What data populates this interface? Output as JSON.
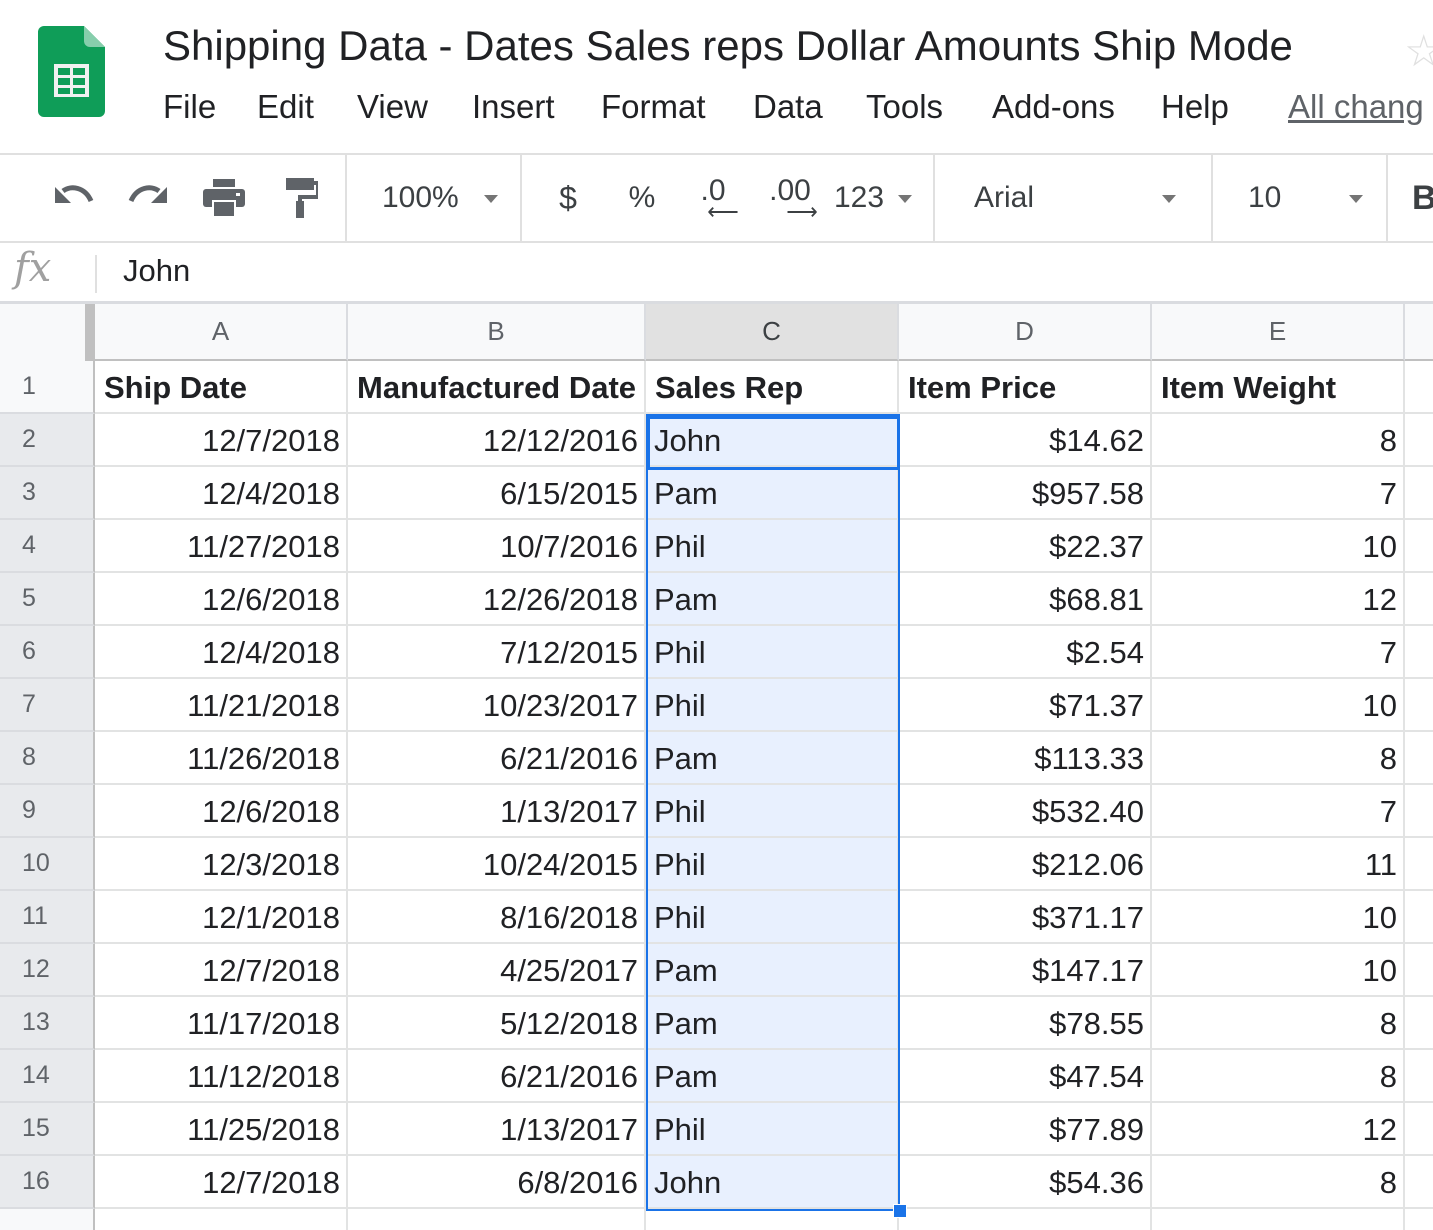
{
  "app": {
    "title": "Shipping Data - Dates Sales reps Dollar Amounts Ship Mode",
    "star_icon": "star-icon",
    "brand_color": "#0f9d58"
  },
  "menu": [
    "File",
    "Edit",
    "View",
    "Insert",
    "Format",
    "Data",
    "Tools",
    "Add-ons",
    "Help"
  ],
  "all_changes": "All chang",
  "toolbar": {
    "zoom": "100%",
    "currency": "$",
    "percent": "%",
    "decrease_decimal": ".0",
    "increase_decimal": ".00",
    "more_formats": "123",
    "font": "Arial",
    "font_size": "10",
    "bold": "B"
  },
  "formula_bar": {
    "fx_label": "fx",
    "value": "John"
  },
  "grid": {
    "columns": [
      "A",
      "B",
      "C",
      "D",
      "E"
    ],
    "selected_column": "C",
    "active_cell": "C2",
    "header": [
      "Ship Date",
      "Manufactured Date",
      "Sales Rep",
      "Item Price",
      "Item Weight"
    ],
    "rows": [
      [
        "12/7/2018",
        "12/12/2016",
        "John",
        "$14.62",
        "8"
      ],
      [
        "12/4/2018",
        "6/15/2015",
        "Pam",
        "$957.58",
        "7"
      ],
      [
        "11/27/2018",
        "10/7/2016",
        "Phil",
        "$22.37",
        "10"
      ],
      [
        "12/6/2018",
        "12/26/2018",
        "Pam",
        "$68.81",
        "12"
      ],
      [
        "12/4/2018",
        "7/12/2015",
        "Phil",
        "$2.54",
        "7"
      ],
      [
        "11/21/2018",
        "10/23/2017",
        "Phil",
        "$71.37",
        "10"
      ],
      [
        "11/26/2018",
        "6/21/2016",
        "Pam",
        "$113.33",
        "8"
      ],
      [
        "12/6/2018",
        "1/13/2017",
        "Phil",
        "$532.40",
        "7"
      ],
      [
        "12/3/2018",
        "10/24/2015",
        "Phil",
        "$212.06",
        "11"
      ],
      [
        "12/1/2018",
        "8/16/2018",
        "Phil",
        "$371.17",
        "10"
      ],
      [
        "12/7/2018",
        "4/25/2017",
        "Pam",
        "$147.17",
        "10"
      ],
      [
        "11/17/2018",
        "5/12/2018",
        "Pam",
        "$78.55",
        "8"
      ],
      [
        "11/12/2018",
        "6/21/2016",
        "Pam",
        "$47.54",
        "8"
      ],
      [
        "11/25/2018",
        "1/13/2017",
        "Phil",
        "$77.89",
        "12"
      ],
      [
        "12/7/2018",
        "6/8/2016",
        "John",
        "$54.36",
        "8"
      ]
    ],
    "row_numbers": [
      "1",
      "2",
      "3",
      "4",
      "5",
      "6",
      "7",
      "8",
      "9",
      "10",
      "11",
      "12",
      "13",
      "14",
      "15",
      "16"
    ]
  }
}
